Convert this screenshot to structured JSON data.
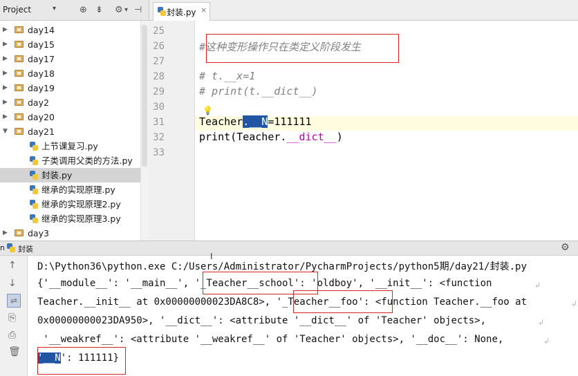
{
  "project_panel": {
    "title": "Project",
    "dropdown_glyph": "▾",
    "toolbar_icons": [
      "target-icon",
      "collapse-icon",
      "gear-icon",
      "hide-icon"
    ],
    "tree": [
      {
        "label": "day14",
        "type": "folder",
        "expanded": false
      },
      {
        "label": "day15",
        "type": "folder",
        "expanded": false
      },
      {
        "label": "day17",
        "type": "folder",
        "expanded": false
      },
      {
        "label": "day18",
        "type": "folder",
        "expanded": false
      },
      {
        "label": "day19",
        "type": "folder",
        "expanded": false
      },
      {
        "label": "day2",
        "type": "folder",
        "expanded": false
      },
      {
        "label": "day20",
        "type": "folder",
        "expanded": false
      },
      {
        "label": "day21",
        "type": "folder",
        "expanded": true
      },
      {
        "label": "上节课复习.py",
        "type": "py"
      },
      {
        "label": "子类调用父类的方法.py",
        "type": "py"
      },
      {
        "label": "封装.py",
        "type": "py",
        "selected": true
      },
      {
        "label": "继承的实现原理.py",
        "type": "py"
      },
      {
        "label": "继承的实现原理2.py",
        "type": "py"
      },
      {
        "label": "继承的实现原理3.py",
        "type": "py"
      },
      {
        "label": "day3",
        "type": "folder",
        "expanded": false
      }
    ]
  },
  "editor": {
    "tab_label": "封装.py",
    "tab_close": "×",
    "lines": [
      {
        "num": "25",
        "text": ""
      },
      {
        "num": "26",
        "text": "#这种变形操作只在类定义阶段发生"
      },
      {
        "num": "27",
        "text": ""
      },
      {
        "num": "28",
        "text": "# t.__x=1"
      },
      {
        "num": "29",
        "text": "# print(t.__dict__)"
      },
      {
        "num": "30",
        "text": ""
      },
      {
        "num": "31",
        "text_pre": "Teacher",
        "text_sel": ".__N",
        "text_post": "=111111"
      },
      {
        "num": "32",
        "text_pre": "print(Teacher.",
        "text_dunder": "__dict__",
        "text_post": ")"
      },
      {
        "num": "33",
        "text": ""
      }
    ]
  },
  "run_panel": {
    "title": "封装",
    "prefix": "n",
    "output": [
      "D:\\Python36\\python.exe C:/Users/Administrator/PycharmProjects/python5期/day21/封装.py",
      "{'__module__': '__main__', '_Teacher__school': 'oldboy', '__init__': <function",
      "Teacher.__init__ at 0x00000000023DA8C8>, '_Teacher__foo': <function Teacher.__foo at",
      "0x00000000023DA950>, '__dict__': <attribute '__dict__' of 'Teacher' objects>,",
      " '__weakref__': <attribute '__weakref__' of 'Teacher' objects>, '__doc__': None,",
      "'__N': 111111}"
    ],
    "side_icons": [
      "arrow-up-icon",
      "arrow-down-icon",
      "wrap-icon",
      "export-icon",
      "print-icon",
      "trash-icon"
    ]
  }
}
